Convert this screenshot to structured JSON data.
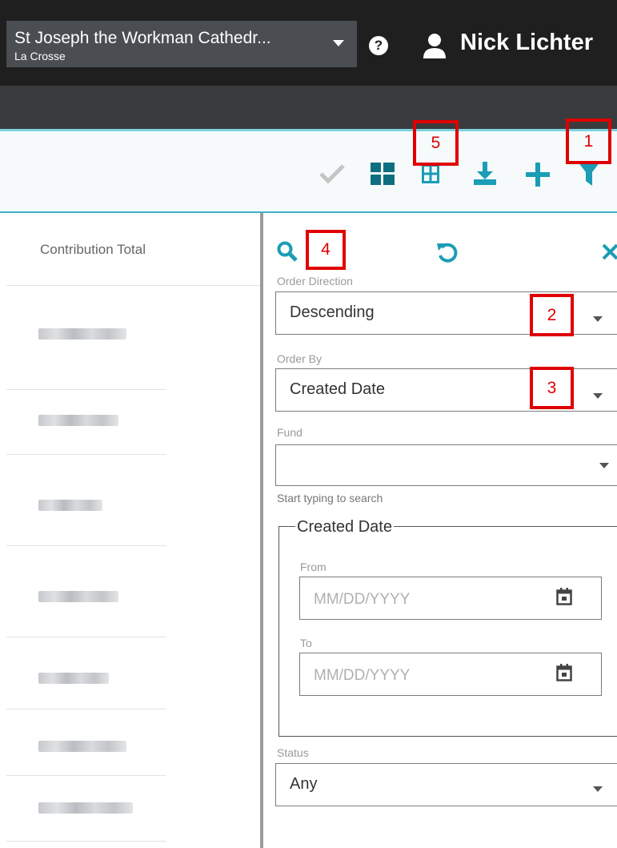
{
  "header": {
    "org_name": "St Joseph the Workman Cathedr...",
    "org_sub": "La Crosse",
    "user_name": "Nick Lichter"
  },
  "toolbar": {
    "icons": [
      "check-icon",
      "grid-large-icon",
      "grid-table-icon",
      "download-icon",
      "plus-icon",
      "filter-icon"
    ],
    "accent_color": "#1a9db5"
  },
  "table": {
    "column_header": "Contribution Total"
  },
  "filter_panel": {
    "order_direction_label": "Order Direction",
    "order_direction_value": "Descending",
    "order_by_label": "Order By",
    "order_by_value": "Created Date",
    "fund_label": "Fund",
    "fund_value": "",
    "fund_helper": "Start typing to search",
    "created_date_legend": "Created Date",
    "from_label": "From",
    "from_placeholder": "MM/DD/YYYY",
    "to_label": "To",
    "to_placeholder": "MM/DD/YYYY",
    "status_label": "Status",
    "status_value": "Any"
  },
  "annotations": [
    "1",
    "2",
    "3",
    "4",
    "5"
  ]
}
